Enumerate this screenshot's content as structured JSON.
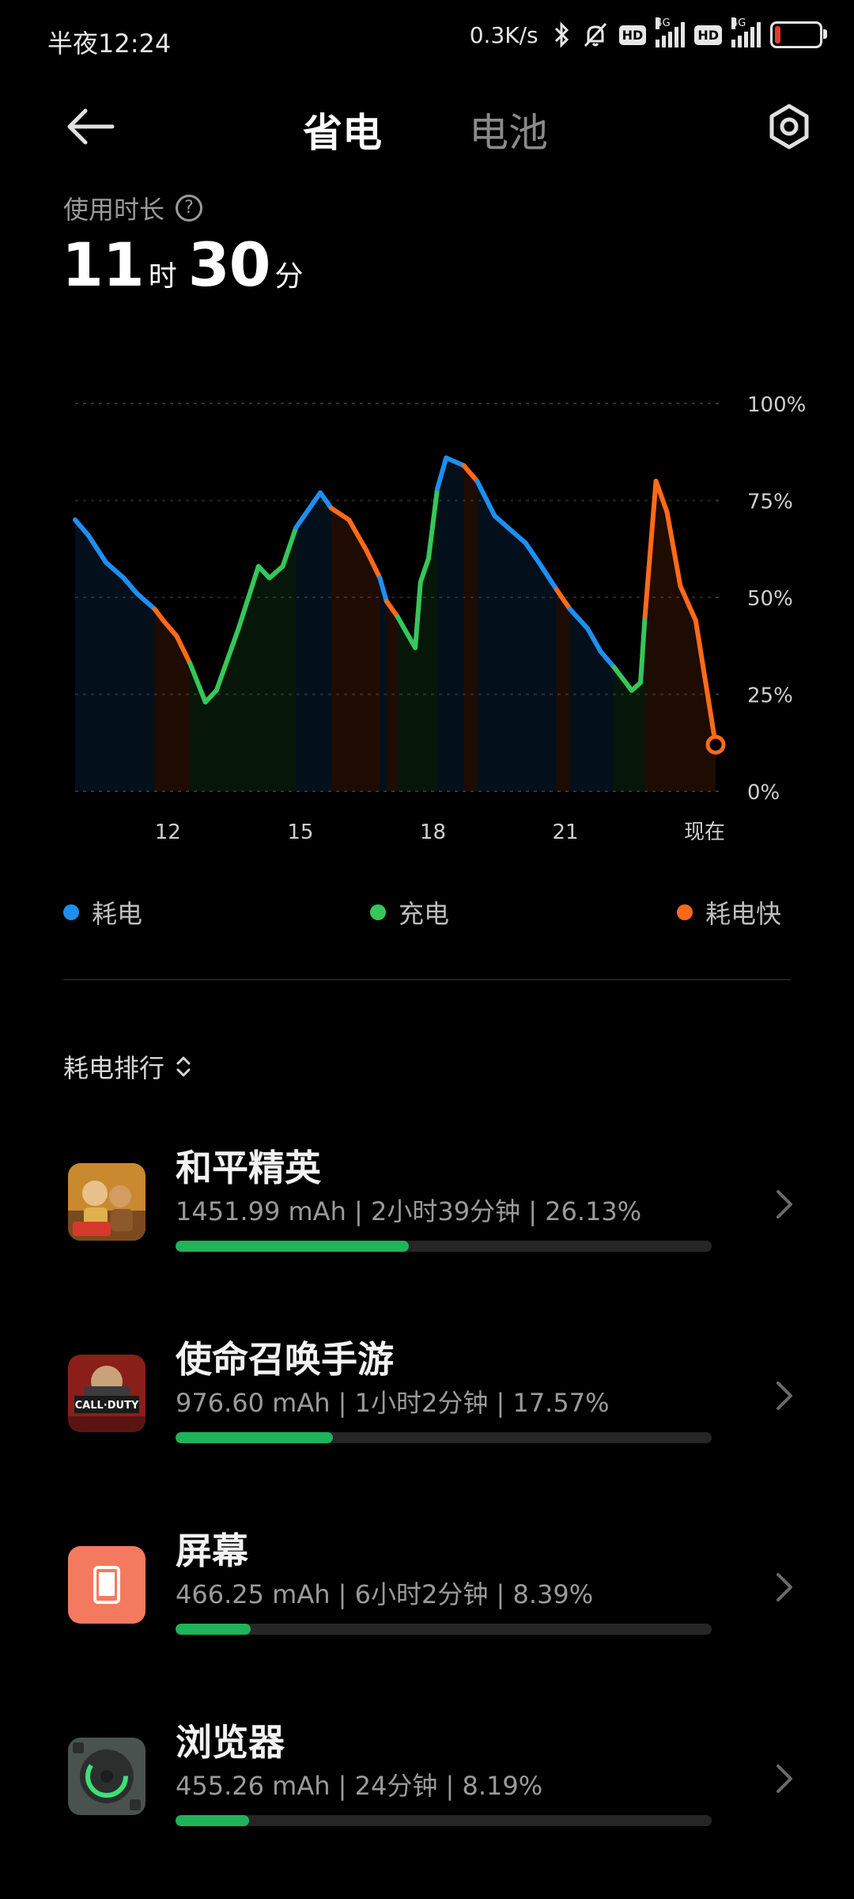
{
  "status_bar": {
    "time": "半夜12:24",
    "net_speed": "0.3K/s",
    "hd": "HD",
    "net_type": "4G"
  },
  "header": {
    "tab_save": "省电",
    "tab_battery": "电池"
  },
  "usage": {
    "label": "使用时长",
    "hours": "11",
    "hours_unit": "时",
    "minutes": "30",
    "minutes_unit": "分"
  },
  "chart_data": {
    "type": "line",
    "y_ticks": [
      "100%",
      "75%",
      "50%",
      "25%",
      "0%"
    ],
    "x_ticks": [
      "12",
      "15",
      "18",
      "21",
      "现在"
    ],
    "ylim": [
      0,
      100
    ],
    "grid": true,
    "colors": {
      "drain": "#1e8ff0",
      "charge": "#35c759",
      "fast_drain": "#ff6a1a"
    },
    "points": [
      {
        "t": 9.9,
        "v": 70,
        "s": "fast_drain"
      },
      {
        "t": 10.2,
        "v": 66,
        "s": "drain"
      },
      {
        "t": 10.6,
        "v": 59,
        "s": "drain"
      },
      {
        "t": 11.0,
        "v": 55,
        "s": "drain"
      },
      {
        "t": 11.3,
        "v": 51,
        "s": "drain"
      },
      {
        "t": 11.7,
        "v": 47,
        "s": "drain"
      },
      {
        "t": 11.9,
        "v": 44,
        "s": "fast_drain"
      },
      {
        "t": 12.2,
        "v": 40,
        "s": "fast_drain"
      },
      {
        "t": 12.5,
        "v": 33,
        "s": "fast_drain"
      },
      {
        "t": 12.85,
        "v": 23,
        "s": "charge"
      },
      {
        "t": 13.1,
        "v": 26,
        "s": "charge"
      },
      {
        "t": 13.6,
        "v": 42,
        "s": "charge"
      },
      {
        "t": 14.05,
        "v": 58,
        "s": "charge"
      },
      {
        "t": 14.3,
        "v": 55,
        "s": "charge"
      },
      {
        "t": 14.6,
        "v": 58,
        "s": "charge"
      },
      {
        "t": 14.9,
        "v": 68,
        "s": "charge"
      },
      {
        "t": 15.45,
        "v": 77,
        "s": "drain"
      },
      {
        "t": 15.7,
        "v": 73,
        "s": "drain"
      },
      {
        "t": 16.1,
        "v": 70,
        "s": "fast_drain"
      },
      {
        "t": 16.5,
        "v": 62,
        "s": "fast_drain"
      },
      {
        "t": 16.8,
        "v": 55,
        "s": "fast_drain"
      },
      {
        "t": 16.95,
        "v": 49,
        "s": "drain"
      },
      {
        "t": 17.2,
        "v": 45,
        "s": "fast_drain"
      },
      {
        "t": 17.6,
        "v": 37,
        "s": "charge"
      },
      {
        "t": 17.72,
        "v": 54,
        "s": "charge"
      },
      {
        "t": 17.9,
        "v": 60,
        "s": "charge"
      },
      {
        "t": 18.1,
        "v": 78,
        "s": "charge"
      },
      {
        "t": 18.3,
        "v": 86,
        "s": "drain"
      },
      {
        "t": 18.7,
        "v": 84,
        "s": "drain"
      },
      {
        "t": 19.0,
        "v": 80,
        "s": "fast_drain"
      },
      {
        "t": 19.4,
        "v": 71,
        "s": "drain"
      },
      {
        "t": 19.8,
        "v": 67,
        "s": "drain"
      },
      {
        "t": 20.1,
        "v": 64,
        "s": "drain"
      },
      {
        "t": 20.4,
        "v": 59,
        "s": "drain"
      },
      {
        "t": 20.8,
        "v": 52,
        "s": "drain"
      },
      {
        "t": 21.1,
        "v": 47,
        "s": "fast_drain"
      },
      {
        "t": 21.5,
        "v": 42,
        "s": "drain"
      },
      {
        "t": 21.8,
        "v": 36,
        "s": "drain"
      },
      {
        "t": 22.1,
        "v": 32,
        "s": "drain"
      },
      {
        "t": 22.5,
        "v": 26,
        "s": "charge"
      },
      {
        "t": 22.7,
        "v": 28,
        "s": "charge"
      },
      {
        "t": 22.8,
        "v": 45,
        "s": "charge"
      },
      {
        "t": 23.05,
        "v": 80,
        "s": "fast_drain"
      },
      {
        "t": 23.3,
        "v": 72,
        "s": "fast_drain"
      },
      {
        "t": 23.6,
        "v": 53,
        "s": "fast_drain"
      },
      {
        "t": 23.95,
        "v": 44,
        "s": "fast_drain"
      },
      {
        "t": 24.4,
        "v": 12,
        "s": "fast_drain"
      }
    ]
  },
  "legend": [
    {
      "label": "耗电",
      "color": "#1e8ff0"
    },
    {
      "label": "充电",
      "color": "#35c759"
    },
    {
      "label": "耗电快",
      "color": "#ff6a1a"
    }
  ],
  "rank": {
    "title": "耗电排行"
  },
  "apps": [
    {
      "name": "和平精英",
      "detail": "1451.99 mAh | 2小时39分钟 | 26.13%",
      "share": 26.13,
      "icon": "game-pubg-icon"
    },
    {
      "name": "使命召唤手游",
      "detail": "976.60 mAh | 1小时2分钟 | 17.57%",
      "share": 17.57,
      "icon": "game-cod-icon"
    },
    {
      "name": "屏幕",
      "detail": "466.25 mAh | 6小时2分钟 | 8.39%",
      "share": 8.39,
      "icon": "screen-icon"
    },
    {
      "name": "浏览器",
      "detail": "455.26 mAh | 24分钟 | 8.19%",
      "share": 8.19,
      "icon": "browser-icon"
    }
  ]
}
